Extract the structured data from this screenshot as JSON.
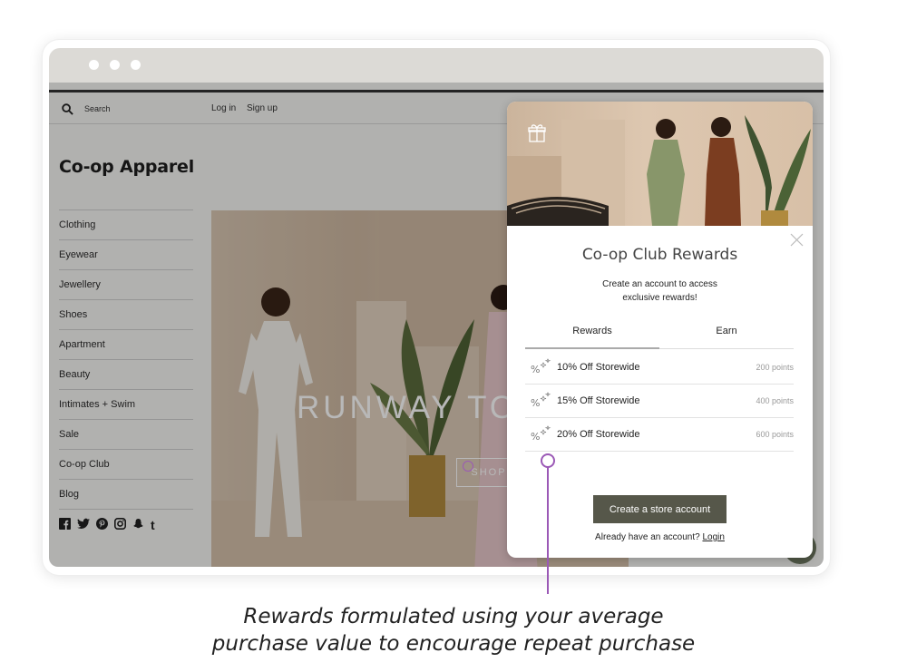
{
  "store": {
    "search_label": "Search",
    "login_label": "Log in",
    "signup_label": "Sign up",
    "brand": "Co-op Apparel",
    "nav": [
      "Clothing",
      "Eyewear",
      "Jewellery",
      "Shoes",
      "Apartment",
      "Beauty",
      "Intimates + Swim",
      "Sale",
      "Co-op Club",
      "Blog"
    ],
    "social_icons": [
      "facebook-icon",
      "twitter-icon",
      "pinterest-icon",
      "instagram-icon",
      "snapchat-icon",
      "tumblr-icon"
    ],
    "hero_title": "RUNWAY TO",
    "hero_button": "SHOP"
  },
  "popup": {
    "title": "Co-op Club Rewards",
    "subtitle": "Create an account to access exclusive rewards!",
    "tabs": [
      "Rewards",
      "Earn"
    ],
    "active_tab": "Rewards",
    "rewards": [
      {
        "label": "10% Off Storewide",
        "points": "200 points"
      },
      {
        "label": "15% Off Storewide",
        "points": "400 points"
      },
      {
        "label": "20% Off Storewide",
        "points": "600 points"
      }
    ],
    "cta": "Create a store account",
    "login_prompt": "Already have an account?",
    "login_link": "Login"
  },
  "caption": {
    "line1": "Rewards formulated using your average",
    "line2": "purchase value to encourage repeat purchase"
  },
  "colors": {
    "cta": "#56574a",
    "annotation": "#9b59b6"
  }
}
